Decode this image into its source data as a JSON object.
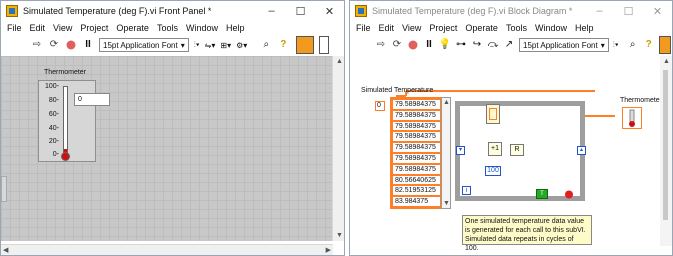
{
  "front_panel": {
    "title": "Simulated Temperature (deg F).vi Front Panel *",
    "window_controls": {
      "minimize": "–",
      "maximize": "☐",
      "close": "✕"
    },
    "menu": [
      "File",
      "Edit",
      "View",
      "Project",
      "Operate",
      "Tools",
      "Window",
      "Help"
    ],
    "font_select": "15pt Application Font",
    "thermometer": {
      "label": "Thermometer",
      "ticks": [
        "100-",
        "80-",
        "60-",
        "40-",
        "20-",
        "0-"
      ],
      "digital_value": "0"
    }
  },
  "block_diagram": {
    "title": "Simulated Temperature (deg F).vi Block Diagram *",
    "window_controls": {
      "minimize": "–",
      "maximize": "☐",
      "close": "✕"
    },
    "menu": [
      "File",
      "Edit",
      "View",
      "Project",
      "Operate",
      "Tools",
      "Window",
      "Help"
    ],
    "font_select": "15pt Application Font",
    "array_label": "Simulated Temperature",
    "array_index": "0",
    "array_values": [
      "79.58984375",
      "79.58984375",
      "79.58984375",
      "79.58984375",
      "79.58984375",
      "79.58984375",
      "79.58984375",
      "80.56640625",
      "82.51953125",
      "83.984375"
    ],
    "constant_100": "100",
    "loop_index": "i",
    "thermometer_label": "Thermometer",
    "comment": [
      "One simulated temperature data value",
      "is generated for each call to this subVI.",
      "Simulated data repeats in cycles of 100."
    ]
  }
}
